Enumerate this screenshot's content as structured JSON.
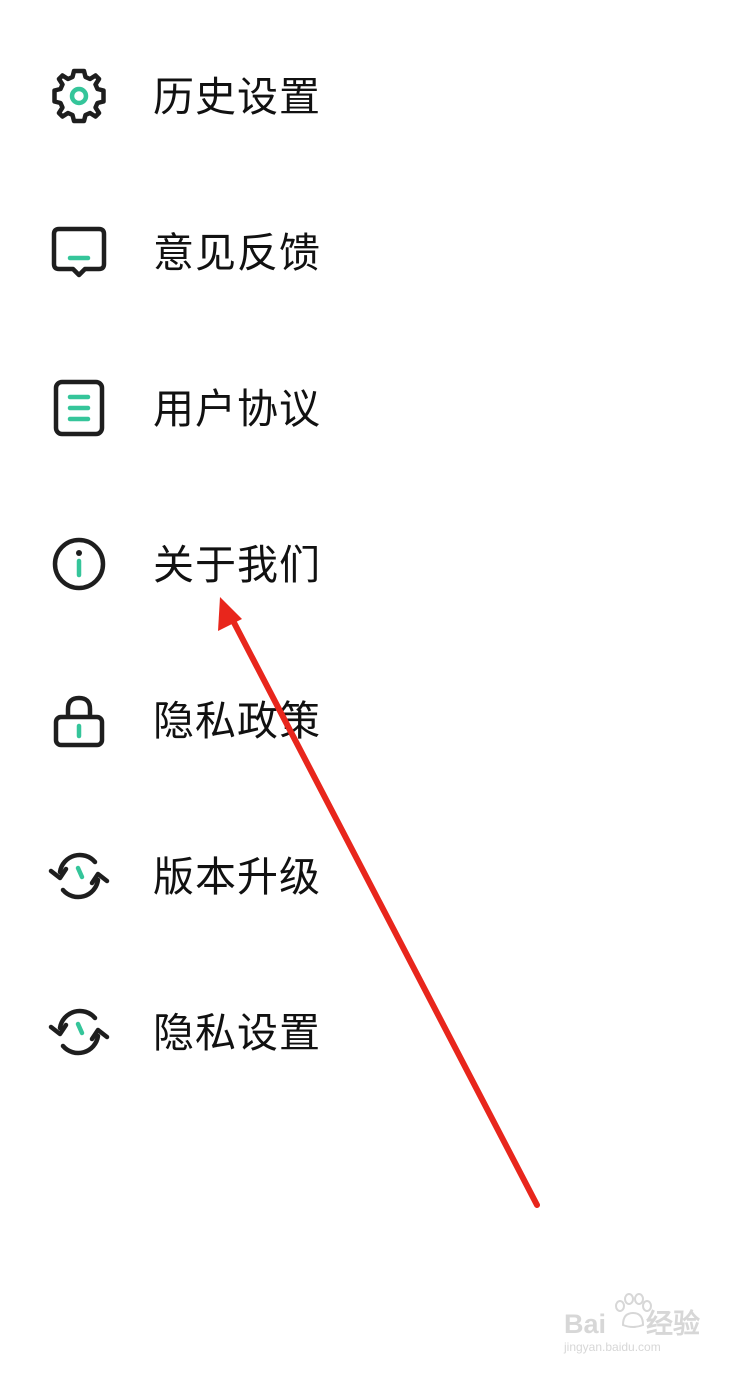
{
  "colors": {
    "icon_dark": "#1e1e1e",
    "icon_accent": "#35c59a",
    "text": "#111111",
    "arrow": "#e8261c",
    "watermark": "#d7d7d7"
  },
  "menu": {
    "items": [
      {
        "label": "历史设置",
        "icon": "gear-icon"
      },
      {
        "label": "意见反馈",
        "icon": "feedback-icon"
      },
      {
        "label": "用户协议",
        "icon": "document-icon"
      },
      {
        "label": "关于我们",
        "icon": "info-icon"
      },
      {
        "label": "隐私政策",
        "icon": "lock-icon"
      },
      {
        "label": "版本升级",
        "icon": "refresh-icon"
      },
      {
        "label": "隐私设置",
        "icon": "refresh-icon"
      }
    ]
  },
  "watermark": {
    "brand": "Bai",
    "brand_suffix": "经验",
    "url": "jingyan.baidu.com"
  }
}
